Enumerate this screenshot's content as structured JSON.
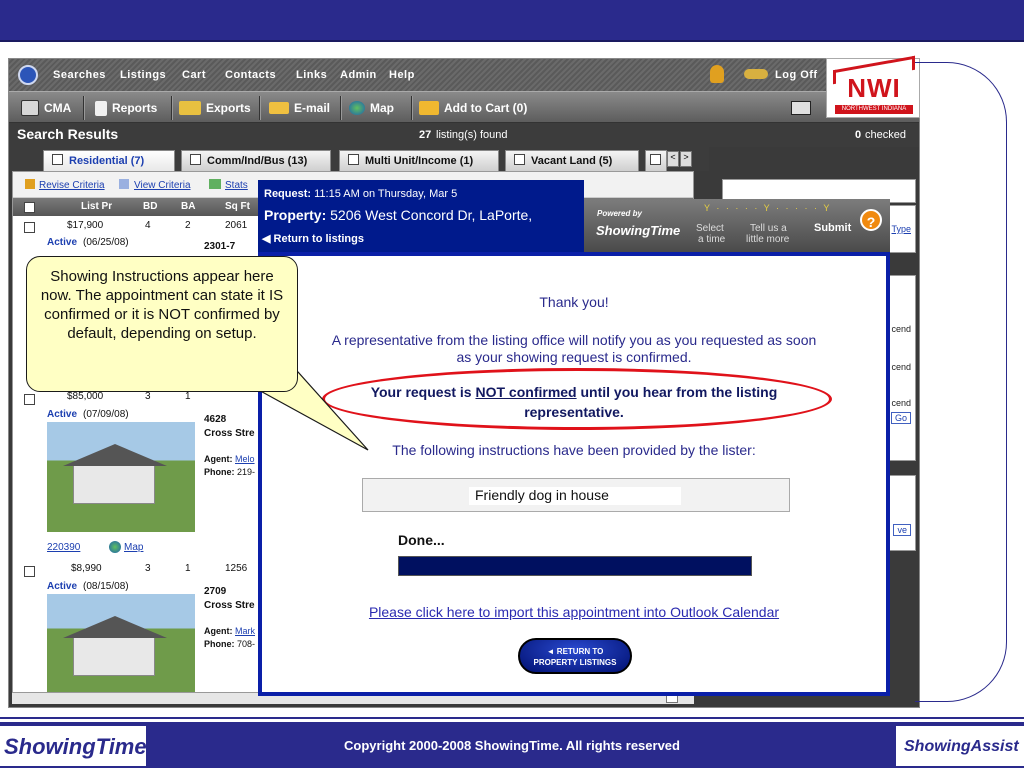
{
  "menu": {
    "items": [
      "Searches",
      "Listings",
      "Cart",
      "Contacts",
      "Links",
      "Admin",
      "Help"
    ],
    "log_off": "Log Off"
  },
  "toolbar": {
    "cma": "CMA",
    "reports": "Reports",
    "exports": "Exports",
    "email": "E-mail",
    "map": "Map",
    "add_to_cart": "Add to Cart (0)"
  },
  "results": {
    "title": "Search Results",
    "count": "27",
    "found_label": "listing(s) found",
    "checked_count": "0",
    "checked_label": "checked"
  },
  "tabs": [
    {
      "label": "Residential (7)"
    },
    {
      "label": "Comm/Ind/Bus (13)"
    },
    {
      "label": "Multi Unit/Income (1)"
    },
    {
      "label": "Vacant Land (5)"
    }
  ],
  "sublinks": {
    "revise": "Revise Criteria",
    "view": "View Criteria",
    "stats": "Stats"
  },
  "list_header": [
    "List Pr",
    "BD",
    "BA",
    "Sq Ft"
  ],
  "listings": [
    {
      "price": "$17,900",
      "bd": "4",
      "ba": "2",
      "sqft": "2061",
      "status": "Active",
      "date": "(06/25/08)",
      "addr": "2301-7"
    },
    {
      "price": "$85,000",
      "bd": "3",
      "ba": "1",
      "sqft": "",
      "status": "Active",
      "date": "(07/09/08)",
      "addr": "4628",
      "street": "Cross Stre",
      "agent_label": "Agent:",
      "agent": "Melo",
      "phone_label": "Phone:",
      "phone": "219-",
      "mls": "220390",
      "map": "Map"
    },
    {
      "price": "$8,990",
      "bd": "3",
      "ba": "1",
      "sqft": "1256",
      "status": "Active",
      "date": "(08/15/08)",
      "addr": "2709",
      "street": "Cross Stre",
      "agent_label": "Agent:",
      "agent": "Mark",
      "phone_label": "Phone:",
      "phone": "708-"
    }
  ],
  "right_snippets": [
    "Type",
    "cend",
    "cend",
    "cend",
    "Go",
    "ve"
  ],
  "request": {
    "request_label": "Request:",
    "request_value": "11:15 AM on Thursday, Mar 5",
    "property_label": "Property:",
    "property_value": "5206 West Concord Dr, LaPorte,",
    "return_link": "Return to listings"
  },
  "showingtime_header": {
    "powered_by": "Powered by",
    "brand": "ShowingTime",
    "step1_a": "Select",
    "step1_b": "a time",
    "step2_a": "Tell us a",
    "step2_b": "little more",
    "step3": "Submit",
    "help": "?"
  },
  "dialog": {
    "thank_you": "Thank you!",
    "notify_1": "A representative from the listing office will notify you as you requested as soon",
    "notify_2": "as your showing request is confirmed.",
    "not_confirmed_pre": "Your request is ",
    "not_confirmed_link": "NOT confirmed",
    "not_confirmed_post": " until you hear from the listing",
    "not_confirmed_2": "representative.",
    "instructions_intro": "The following instructions have been provided by the lister:",
    "instructions": "Friendly dog in house",
    "done": "Done...",
    "outlook_link": "Please click here to import this appointment into Outlook Calendar",
    "return_btn_1": "◄ RETURN TO",
    "return_btn_2": "PROPERTY LISTINGS"
  },
  "callout": {
    "text": "Showing Instructions appear here now.  The appointment can state it IS confirmed or it is NOT confirmed by default, depending on setup."
  },
  "nwi_logo": {
    "main": "NWI",
    "sub": "NORTHWEST INDIANA"
  },
  "footer": {
    "left_logo": "ShowingTime",
    "copyright": "Copyright 2000-2008 ShowingTime.  All rights reserved",
    "right_logo": "ShowingAssist"
  },
  "colors": {
    "slide_blue": "#2a2a8c",
    "dialog_blue": "#0a1fa8",
    "link_blue": "#1c3fb0",
    "ellipse_red": "#e0121a",
    "callout_yellow": "#ffffc4"
  }
}
